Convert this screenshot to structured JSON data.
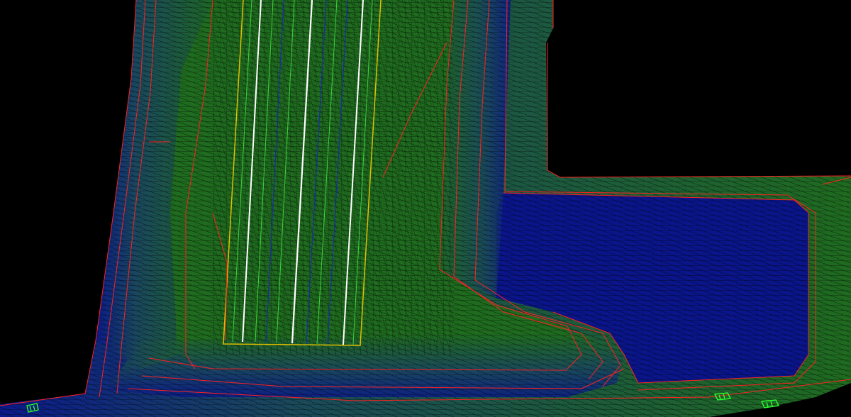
{
  "colors": {
    "background": "#000000",
    "surface_green": "#1f6b1f",
    "surface_green_dark": "#1a4d2a",
    "surface_teal": "#1a4a5a",
    "surface_blue": "#0b1a8a",
    "surface_blue_deep": "#070f6e",
    "contour_red": "#ff2020",
    "mesh_black": "#000000",
    "road_white": "#ffffff",
    "road_yellow": "#e0c000",
    "road_green": "#3cd23c",
    "road_blue": "#1a2ab0",
    "marker_green": "#2cff2c"
  },
  "scene": {
    "type": "3d-terrain-mesh-view",
    "markers": [
      {
        "id": "marker-left-bottom",
        "icon": "survey-point-icon"
      },
      {
        "id": "marker-right-bottom-1",
        "icon": "survey-point-icon"
      },
      {
        "id": "marker-right-bottom-2",
        "icon": "survey-point-icon"
      }
    ]
  }
}
